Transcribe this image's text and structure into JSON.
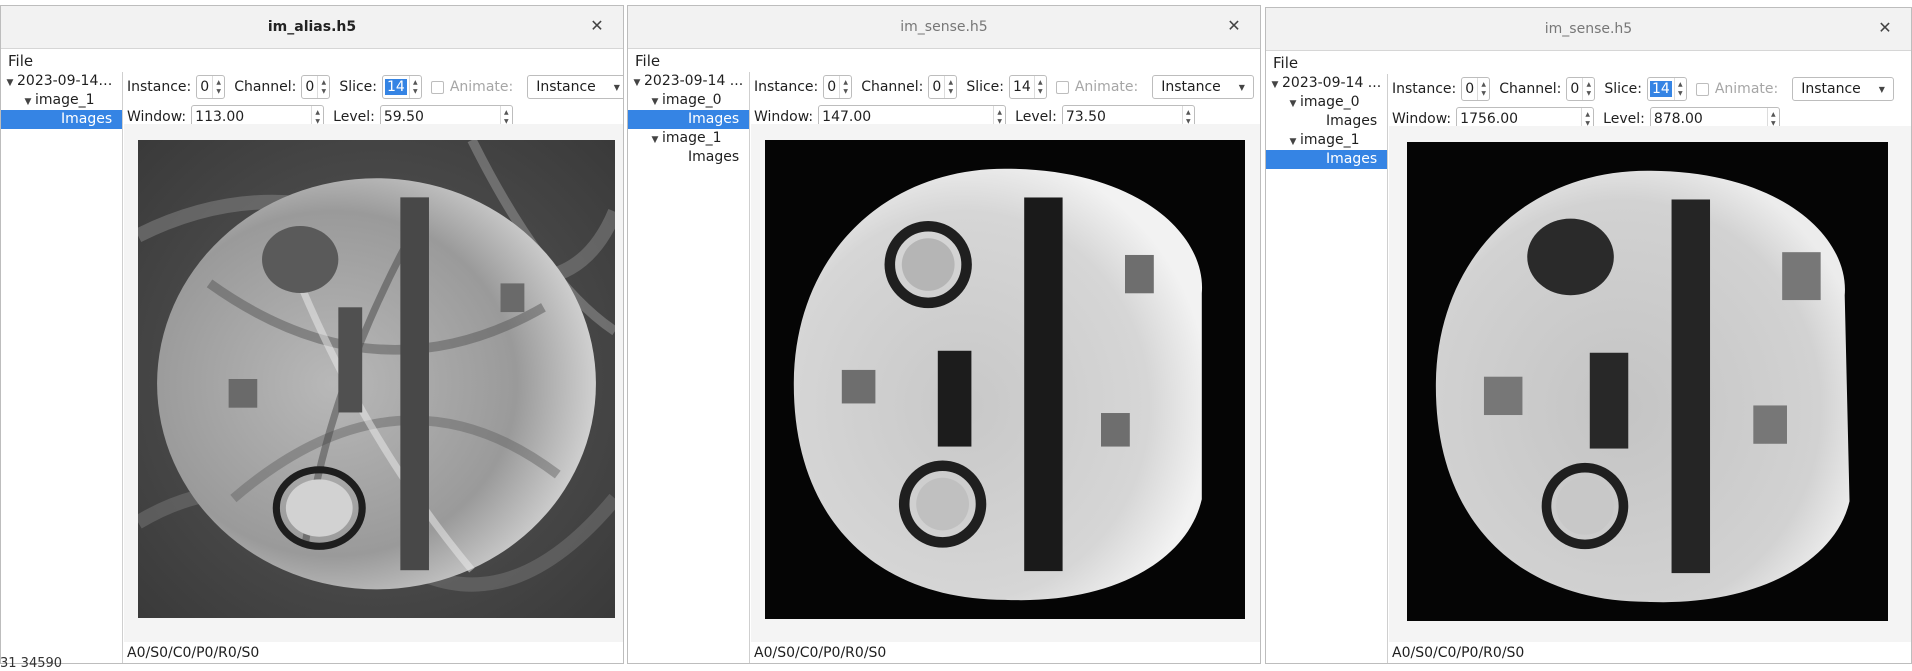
{
  "coordinate_readout": "31 34590",
  "windows": [
    {
      "title": "im_alias.h5",
      "active": true,
      "menu": [
        "File"
      ],
      "tree": [
        {
          "label": "2023-09-14…",
          "arrow": "open",
          "level": 0,
          "selected": false
        },
        {
          "label": "image_1",
          "arrow": "open",
          "level": 1,
          "selected": false
        },
        {
          "label": "Images",
          "arrow": "none",
          "level": 2,
          "selected": true
        }
      ],
      "controls": {
        "instance_label": "Instance:",
        "instance": "0",
        "channel_label": "Channel:",
        "channel": "0",
        "slice_label": "Slice:",
        "slice": "14",
        "animate_label": "Animate:",
        "mode": "Instance",
        "window_label": "Window:",
        "window": "113.00",
        "level_label": "Level:",
        "level": "59.50"
      },
      "image_kind": "aliased",
      "status": "A0/S0/C0/P0/R0/S0"
    },
    {
      "title": "im_sense.h5",
      "active": false,
      "menu": [
        "File"
      ],
      "tree": [
        {
          "label": "2023-09-14 ...",
          "arrow": "open",
          "level": 0,
          "selected": false
        },
        {
          "label": "image_0",
          "arrow": "open",
          "level": 1,
          "selected": false
        },
        {
          "label": "Images",
          "arrow": "none",
          "level": 2,
          "selected": true
        },
        {
          "label": "image_1",
          "arrow": "open",
          "level": 1,
          "selected": false
        },
        {
          "label": "Images",
          "arrow": "none",
          "level": 2,
          "selected": false
        }
      ],
      "controls": {
        "instance_label": "Instance:",
        "instance": "0",
        "channel_label": "Channel:",
        "channel": "0",
        "slice_label": "Slice:",
        "slice": "14",
        "animate_label": "Animate:",
        "mode": "Instance",
        "window_label": "Window:",
        "window": "147.00",
        "level_label": "Level:",
        "level": "73.50"
      },
      "image_kind": "sense0",
      "status": "A0/S0/C0/P0/R0/S0"
    },
    {
      "title": "im_sense.h5",
      "active": false,
      "menu": [
        "File"
      ],
      "tree": [
        {
          "label": "2023-09-14 ...",
          "arrow": "open",
          "level": 0,
          "selected": false
        },
        {
          "label": "image_0",
          "arrow": "open",
          "level": 1,
          "selected": false
        },
        {
          "label": "Images",
          "arrow": "none",
          "level": 2,
          "selected": false
        },
        {
          "label": "image_1",
          "arrow": "open",
          "level": 1,
          "selected": false
        },
        {
          "label": "Images",
          "arrow": "none",
          "level": 2,
          "selected": true
        }
      ],
      "controls": {
        "instance_label": "Instance:",
        "instance": "0",
        "channel_label": "Channel:",
        "channel": "0",
        "slice_label": "Slice:",
        "slice": "14",
        "animate_label": "Animate:",
        "mode": "Instance",
        "window_label": "Window:",
        "window": "1756.00",
        "level_label": "Level:",
        "level": "878.00"
      },
      "image_kind": "sense1",
      "status": "A0/S0/C0/P0/R0/S0"
    }
  ]
}
